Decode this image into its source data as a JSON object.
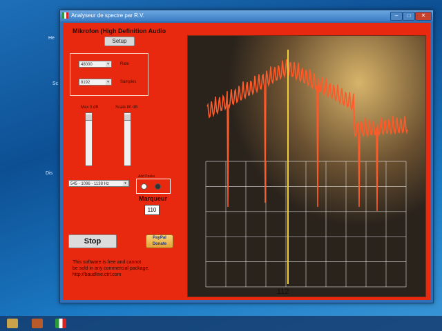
{
  "desktop": {
    "labels": [
      "He",
      "Sc",
      "Dis"
    ]
  },
  "window": {
    "title": "Analyseur de spectre par R.V.",
    "device_title": "Mikrofon (High Definition Audio",
    "setup_label": "Setup",
    "rate_label": "Rate",
    "samples_label": "Samples",
    "rate_value": "48000",
    "samples_value": "8192",
    "slider1_label": "Max 0 dB",
    "slider2_label": "Scale 80 dB",
    "range_combo": "545 - 1096 - 1138 Hz",
    "peak_group_label": "Add Peaks",
    "marker_label": "Marqueur",
    "marker_value": "110",
    "stop_label": "Stop",
    "paypal_label": "PayPal",
    "paypal_sub": "Donate",
    "note_lines": [
      "This software is free and cannot",
      "be sold in any commercial package.",
      "http://baudline.ctrl.com"
    ],
    "frequency_readout": "112",
    "minimize_glyph": "–",
    "maximize_glyph": "□",
    "close_glyph": "✕"
  },
  "colors": {
    "panel": "#e8290f",
    "trace": "#ff5a2a",
    "marker_line": "#f2d03a",
    "grid": "#e8e8e8"
  }
}
